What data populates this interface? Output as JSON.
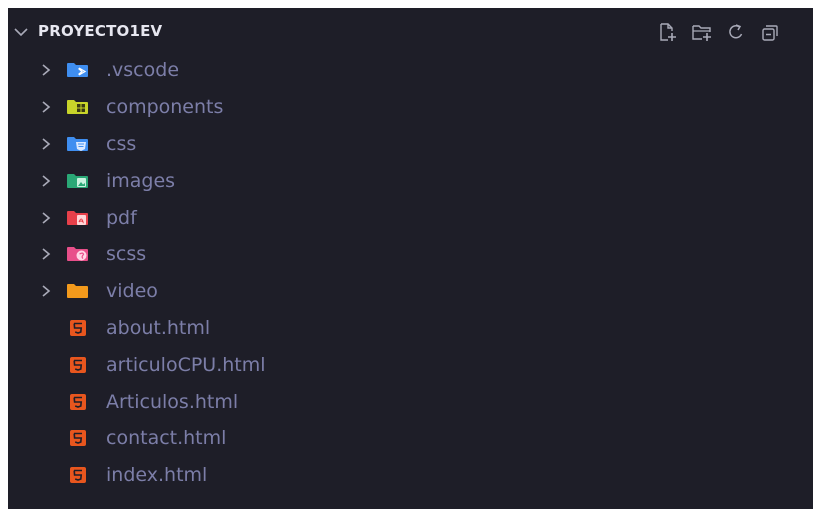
{
  "explorer": {
    "project_name": "PROYECTO1EV",
    "actions": [
      {
        "name": "new-file-icon",
        "title": "New File"
      },
      {
        "name": "new-folder-icon",
        "title": "New Folder"
      },
      {
        "name": "refresh-icon",
        "title": "Refresh Explorer"
      },
      {
        "name": "collapse-all-icon",
        "title": "Collapse Folders in Explorer"
      }
    ],
    "items": [
      {
        "label": ".vscode",
        "type": "folder",
        "icon": "vscode-folder-icon",
        "color": "#3f8ef0"
      },
      {
        "label": "components",
        "type": "folder",
        "icon": "components-folder-icon",
        "color": "#c8d42a"
      },
      {
        "label": "css",
        "type": "folder",
        "icon": "css-folder-icon",
        "color": "#3f8ef0"
      },
      {
        "label": "images",
        "type": "folder",
        "icon": "images-folder-icon",
        "color": "#2aa876"
      },
      {
        "label": "pdf",
        "type": "folder",
        "icon": "pdf-folder-icon",
        "color": "#e8404a"
      },
      {
        "label": "scss",
        "type": "folder",
        "icon": "scss-folder-icon",
        "color": "#e84f8a"
      },
      {
        "label": "video",
        "type": "folder",
        "icon": "video-folder-icon",
        "color": "#f39a1c"
      },
      {
        "label": "about.html",
        "type": "file",
        "icon": "html5-icon",
        "color": "#e8561e"
      },
      {
        "label": "articuloCPU.html",
        "type": "file",
        "icon": "html5-icon",
        "color": "#e8561e"
      },
      {
        "label": "Articulos.html",
        "type": "file",
        "icon": "html5-icon",
        "color": "#e8561e"
      },
      {
        "label": "contact.html",
        "type": "file",
        "icon": "html5-icon",
        "color": "#e8561e"
      },
      {
        "label": "index.html",
        "type": "file",
        "icon": "html5-icon",
        "color": "#e8561e"
      }
    ]
  },
  "colors": {
    "background": "#1e1e28",
    "label": "#7c7ea8",
    "header_text": "#e7e7f0",
    "icon_gray": "#a9aab8"
  }
}
